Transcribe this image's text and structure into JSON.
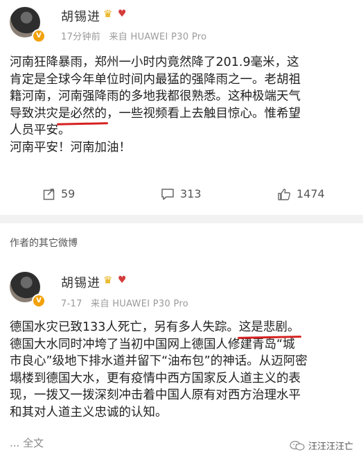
{
  "post1": {
    "author": "胡锡进",
    "time": "17分钟前",
    "source": "来自 HUAWEI P30 Pro",
    "lines": [
      "河南狂降暴雨，郑州一小时内竟然降了201.9毫米，这",
      "肯定是全球今年单位时间内最猛的强降雨之一。老胡祖",
      "籍河南，河南强降雨的多地我都很熟悉。这种极端天气"
    ],
    "line4_pre": "导致洪灾",
    "line4_underlined": "是必然的",
    "line4_post": "，一些视频看上去触目惊心。惟希望",
    "line5": "人员平安。",
    "line6": "河南平安！河南加油！",
    "repost_count": "59",
    "comment_count": "313",
    "like_count": "1474"
  },
  "other_posts_header": "作者的其它微博",
  "post2": {
    "author": "胡锡进",
    "time": "7-17",
    "source": "来自 HUAWEI P30 Pro",
    "line1_pre": "德国水灾已致133人死亡，另有多人失踪。",
    "line1_underlined": "这是悲剧。",
    "lines": [
      "德国大水同时冲垮了当初中国网上德国人修建青岛“城",
      "市良心”级地下排水道并留下“油布包”的神话。从迈阿密",
      "塌楼到德国大水，更有疫情中西方国家反人道主义的表",
      "现，一拨又一拨深刻冲击着中国人原有对西方治理水平",
      "和其对人道主义忠诚的认知。"
    ],
    "more_label": "... 全文"
  },
  "watermark": "汪汪汪汪亡",
  "icons": {
    "verified": "verified-v-badge",
    "crown": "crown-icon",
    "heart": "heart-icon",
    "repost": "repost-icon",
    "comment": "comment-icon",
    "like": "like-icon"
  },
  "colors": {
    "underline": "#d62020",
    "verified_badge": "#f3a10a",
    "divider": "#f2f2f2"
  }
}
